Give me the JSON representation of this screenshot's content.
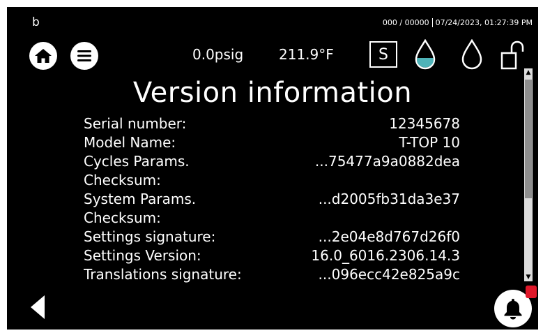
{
  "header": {
    "corner_letter": "b",
    "counter": "000 / 00000",
    "datetime": "07/24/2023, 01:27:39 PM",
    "pressure": "0.0psig",
    "temperature": "211.9°F",
    "mode_letter": "S",
    "icons": [
      "home-icon",
      "menu-icon",
      "water-drop-filled-icon",
      "water-drop-outline-icon",
      "unlocked-padlock-icon"
    ]
  },
  "page": {
    "title": "Version information"
  },
  "rows": [
    {
      "key": "Serial number:",
      "value": "12345678"
    },
    {
      "key": "Model Name:",
      "value": "T-TOP 10"
    },
    {
      "key": "Cycles Params.",
      "value": "...75477a9a0882dea"
    },
    {
      "key": "Checksum:",
      "value": ""
    },
    {
      "key": "System Params.",
      "value": "...d2005fb31da3e37"
    },
    {
      "key": "Checksum:",
      "value": ""
    },
    {
      "key": "Settings signature:",
      "value": "...2e04e8d767d26f0"
    },
    {
      "key": "Settings Version:",
      "value": "16.0_6016.2306.14.3"
    },
    {
      "key": "Translations signature:",
      "value": "...096ecc42e825a9c"
    }
  ],
  "footer": {
    "icons": [
      "back-arrow-icon",
      "bell-icon"
    ]
  },
  "colors": {
    "background": "#000000",
    "foreground": "#ffffff",
    "drop_fill": "#4fb3b8",
    "badge": "#e0182a",
    "scroll_track": "#dcdcdc",
    "scroll_thumb": "#8e8e8e"
  }
}
